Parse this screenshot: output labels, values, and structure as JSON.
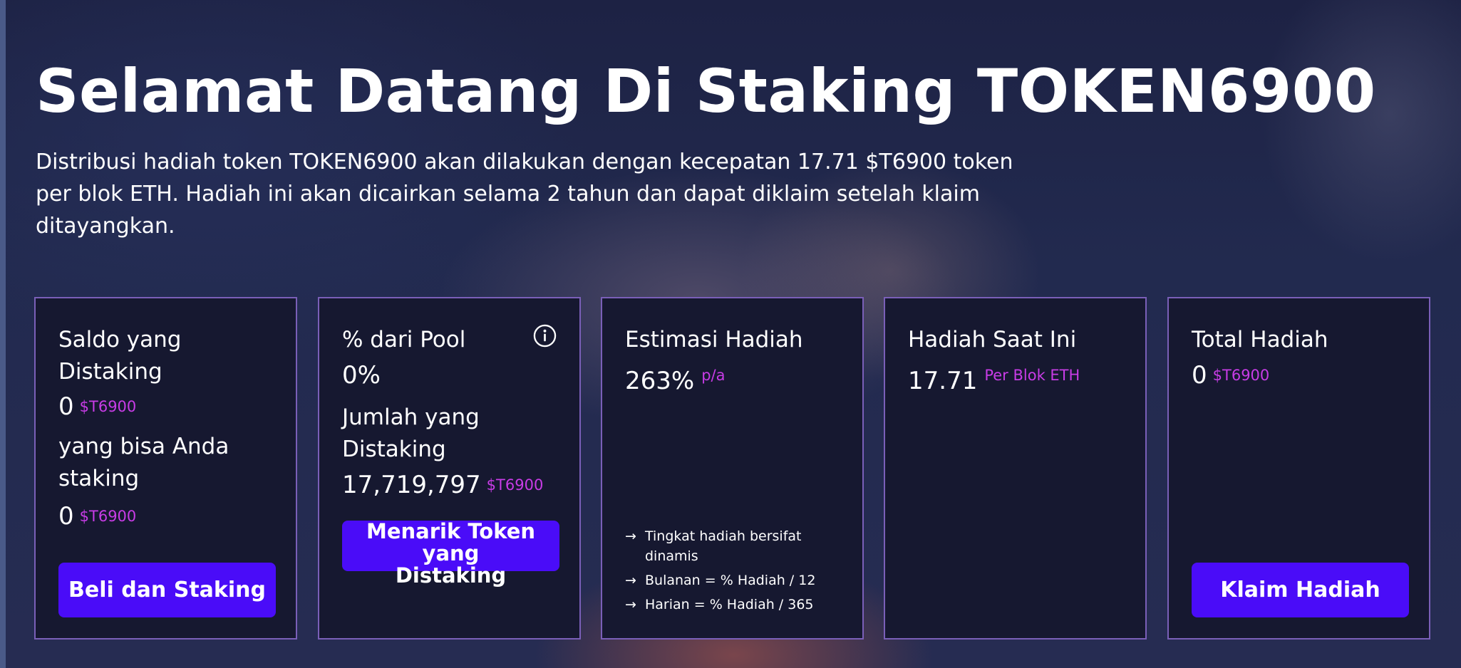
{
  "header": {
    "title": "Selamat Datang Di Staking TOKEN6900",
    "description": "Distribusi hadiah token TOKEN6900 akan dilakukan dengan kecepatan 17.71 $T6900 token per blok ETH. Hadiah ini akan dicairkan selama 2 tahun dan dapat diklaim setelah klaim ditayangkan."
  },
  "cards": {
    "staked": {
      "label": "Saldo yang Distaking",
      "value": "0",
      "unit": "$T6900",
      "available_label": "yang bisa Anda staking",
      "available_value": "0",
      "available_unit": "$T6900",
      "button": "Beli dan Staking"
    },
    "pool": {
      "label": "% dari Pool",
      "value": "0%",
      "total_label": "Jumlah yang Distaking",
      "total_value": "17,719,797",
      "total_unit": "$T6900",
      "button": "Menarik Token yang Distaking",
      "icon": "info-icon"
    },
    "estimate": {
      "label": "Estimasi Hadiah",
      "value": "263%",
      "unit": "p/a",
      "notes": [
        "Tingkat hadiah bersifat dinamis",
        "Bulanan = % Hadiah / 12",
        "Harian = % Hadiah / 365"
      ],
      "note_icon": "arrow-right-icon"
    },
    "current": {
      "label": "Hadiah Saat Ini",
      "value": "17.71",
      "unit": "Per Blok ETH"
    },
    "total": {
      "label": "Total Hadiah",
      "value": "0",
      "unit": "$T6900",
      "button": "Klaim Hadiah"
    }
  },
  "colors": {
    "accent_button": "#4a0cf8",
    "unit_text": "#c83ce6",
    "card_bg": "#161830",
    "card_border": "#7a5fb8"
  }
}
